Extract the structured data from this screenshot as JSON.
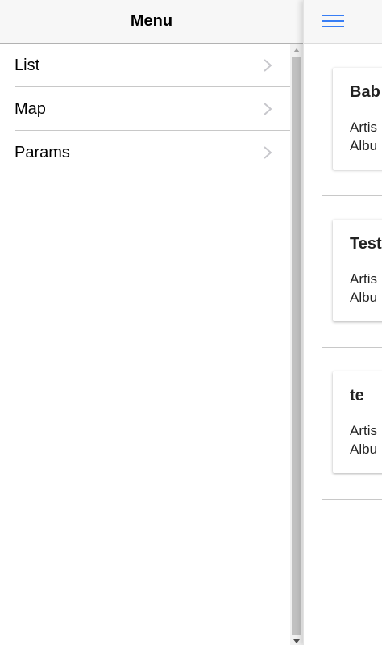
{
  "menu": {
    "title": "Menu",
    "items": [
      {
        "label": "List"
      },
      {
        "label": "Map"
      },
      {
        "label": "Params"
      }
    ]
  },
  "cards": [
    {
      "title": "Bab",
      "artist_label": "Artis",
      "album_label": "Albu"
    },
    {
      "title": "Test",
      "artist_label": "Artis",
      "album_label": "Albu"
    },
    {
      "title": "te",
      "artist_label": "Artis",
      "album_label": "Albu"
    }
  ],
  "colors": {
    "accent": "#387ef5",
    "header_bg": "#f7f7f7",
    "separator": "#c8c8c8"
  },
  "icons": {
    "menu_toggle": "hamburger-icon",
    "item_arrow": "chevron-right-icon"
  }
}
